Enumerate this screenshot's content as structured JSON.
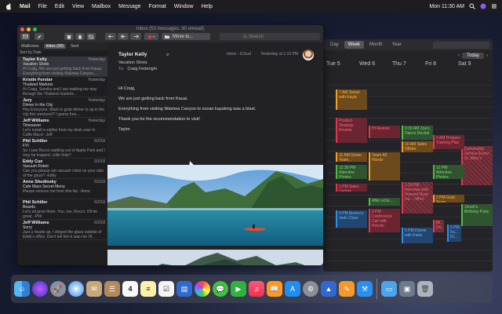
{
  "menubar": {
    "app": "Mail",
    "items": [
      "File",
      "Edit",
      "View",
      "Mailbox",
      "Message",
      "Format",
      "Window",
      "Help"
    ],
    "clock": "Mon 11:30 AM"
  },
  "mail": {
    "window_title": "Inbox (53 messages, 30 unread)",
    "toolbar": {
      "move_to": "Move to...",
      "search_placeholder": "Search"
    },
    "favorites": [
      "Mailboxes",
      "Inbox (30)",
      "Sent"
    ],
    "sort_label": "Sort by Date",
    "messages": [
      {
        "from": "Taylor Kelly",
        "date": "Yesterday",
        "subject": "Vacation Shots",
        "preview": "Hi Craig, We are just getting back from Kauai. Everything from visiting Waimea Canyon..."
      },
      {
        "from": "Kristin Forster",
        "date": "Yesterday",
        "subject": "Thailand Markets",
        "preview": "Hi Craig, Sandra and I are making our way through the Thailand markets..."
      },
      {
        "from": "Jury",
        "date": "Yesterday",
        "subject": "Dinner in the City",
        "preview": "Hey Everyone, Want to grab dinner to up in the city this weekend? I guess free..."
      },
      {
        "from": "Jeff Williams",
        "date": "Yesterday",
        "subject": "Timesaver",
        "preview": "Let's install a zipline from my desk over to Caffe Macs! -Jeff"
      },
      {
        "from": "Phil Schiller",
        "date": "6/2/18",
        "subject": "FYI",
        "preview": "So I saw Rocco walking out of Apple Park and I may be trapped. Little help?"
      },
      {
        "from": "Eddy Cue",
        "date": "6/2/18",
        "subject": "Vacuum Robot",
        "preview": "Can you please set vacuum robot on your side of the glass? -Eddy"
      },
      {
        "from": "Anne Shedlosky",
        "date": "6/2/18",
        "subject": "Cafe Macs Secret Menu",
        "preview": "Please remove me from this list. -Anne"
      },
      {
        "from": "Phil Schiller",
        "date": "6/2/18",
        "subject": "Beards",
        "preview": "Let's all grow them. You, me, Rocco. It'll be great. -Phil"
      },
      {
        "from": "Jeff Williams",
        "date": "6/2/18",
        "subject": "Sorry",
        "preview": "Just a heads up, I dinged the glass outside of Eddy's office. Don't tell him it was me I'll..."
      }
    ],
    "reader": {
      "sender": "Taylor Kelly",
      "subject": "Vacation Shots",
      "to_label": "To:",
      "to": "Craig Federighi",
      "mailbox": "Inbox - iCloud",
      "time": "Yesterday at 1:10 PM",
      "body": [
        "Hi Craig,",
        "We are just getting back from Kauai.",
        "Everything from visiting Waimea Canyon to ocean kayaking was a blast.",
        "Thank you for the recommendation to visit!",
        "Taylor"
      ]
    }
  },
  "calendar": {
    "views": [
      "Day",
      "Week",
      "Month",
      "Year"
    ],
    "today_button": "Today",
    "days": [
      "Tue 5",
      "Wed 6",
      "Thu 7",
      "Fri 8",
      "Sat 9"
    ],
    "events": [
      {
        "text": "7 AM Sweat with Kayla",
        "color": "orange"
      },
      {
        "text": "Community Service Event St. Mary's",
        "color": "red"
      },
      {
        "text": "Product Strategy Review",
        "color": "red"
      },
      {
        "text": "HI Review",
        "color": "red"
      },
      {
        "text": "9:30 AM Zoe's Dance Recital",
        "color": "green"
      },
      {
        "text": "9 AM Prepare Training Plan",
        "color": "red"
      },
      {
        "text": "10 AM Sales Offsite",
        "color": "orange"
      },
      {
        "text": "11 AM Green Team...",
        "color": "orange"
      },
      {
        "text": "Team All Hands",
        "color": "orange"
      },
      {
        "text": "12:30 PM Attendee Photos",
        "color": "green"
      },
      {
        "text": "12 PM Attendee Photos",
        "color": "green"
      },
      {
        "text": "1:30 PM Interview with Howard Ryan Ha... Office",
        "color": "red"
      },
      {
        "text": "1 PM Sales Update",
        "color": "red"
      },
      {
        "text": "After scho...",
        "color": "green"
      },
      {
        "text": "2 PM Gold Team...",
        "color": "orange"
      },
      {
        "text": "3 PM Conference Call with Hiroshi",
        "color": "red"
      },
      {
        "text": "Jonah's Birthday Party",
        "color": "green"
      },
      {
        "text": "5 PM Aurora's Judo Class",
        "color": "blue"
      },
      {
        "text": "5 PM Dinner with Kiara",
        "color": "blue"
      },
      {
        "text": "Mi... Do...",
        "color": "red"
      },
      {
        "text": "5 PM Fa... Di...",
        "color": "blue"
      }
    ]
  },
  "dock": {
    "apps": [
      "finder-icon",
      "siri-icon",
      "launchpad-icon",
      "safari-icon",
      "mail-stamp-icon",
      "contacts-icon",
      "calendar-icon",
      "notes-icon",
      "reminders-icon",
      "keynote-icon",
      "photos-icon",
      "messages-icon",
      "facetime-icon",
      "music-icon",
      "books-icon",
      "app-store-icon",
      "system-preferences-icon",
      "keynote-podium-icon",
      "pages-icon",
      "xcode-icon"
    ],
    "calendar_date": "4",
    "trailing": [
      "downloads-folder-icon",
      "preview-icon",
      "trash-icon"
    ]
  }
}
